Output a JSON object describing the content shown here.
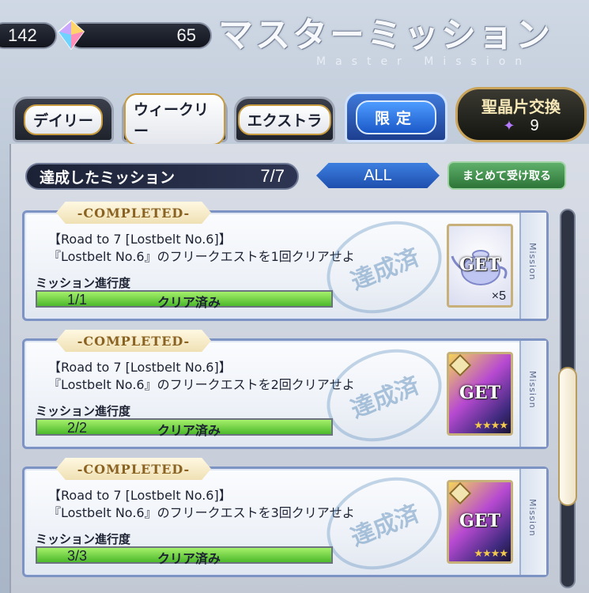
{
  "header": {
    "ap": "142",
    "qp": "65",
    "title": "マスターミッション",
    "subtitle": "Master Mission"
  },
  "tabs": [
    {
      "label": "デイリー",
      "active": false
    },
    {
      "label": "ウィークリー",
      "active": false
    },
    {
      "label": "エクストラ",
      "active": false
    },
    {
      "label": "限定",
      "active": true
    }
  ],
  "exchange": {
    "label": "聖晶片交換",
    "count": "9"
  },
  "summary": {
    "label": "達成したミッション",
    "count": "7/7"
  },
  "filter": {
    "label": "ALL"
  },
  "receive_all": {
    "label": "まとめて受け取る"
  },
  "colors": {
    "accent": "#1f4fae",
    "progress": "#4cb92a",
    "card_border": "#7d93c4"
  },
  "missions": [
    {
      "status": "-COMPLETED-",
      "line1": "【Road to 7 [Lostbelt No.6]】",
      "line2": "『Lostbelt No.6』のフリークエストを1回クリアせよ",
      "progress_label": "ミッション進行度",
      "progress": 1.0,
      "ratio": "1/1",
      "cleared": "クリア済み",
      "stamp": "達成済",
      "reward_get": "GET",
      "reward_qty": "×5",
      "reward_icon": "teapot-icon",
      "side": "Mission"
    },
    {
      "status": "-COMPLETED-",
      "line1": "【Road to 7 [Lostbelt No.6]】",
      "line2": "『Lostbelt No.6』のフリークエストを2回クリアせよ",
      "progress_label": "ミッション進行度",
      "progress": 1.0,
      "ratio": "2/2",
      "cleared": "クリア済み",
      "stamp": "達成済",
      "reward_get": "GET",
      "reward_stars": "★★★★",
      "reward_icon": "servant-card-icon",
      "side": "Mission"
    },
    {
      "status": "-COMPLETED-",
      "line1": "【Road to 7 [Lostbelt No.6]】",
      "line2": "『Lostbelt No.6』のフリークエストを3回クリアせよ",
      "progress_label": "ミッション進行度",
      "progress": 1.0,
      "ratio": "3/3",
      "cleared": "クリア済み",
      "stamp": "達成済",
      "reward_get": "GET",
      "reward_stars": "★★★★",
      "reward_icon": "servant-card-icon",
      "side": "Mission"
    }
  ]
}
